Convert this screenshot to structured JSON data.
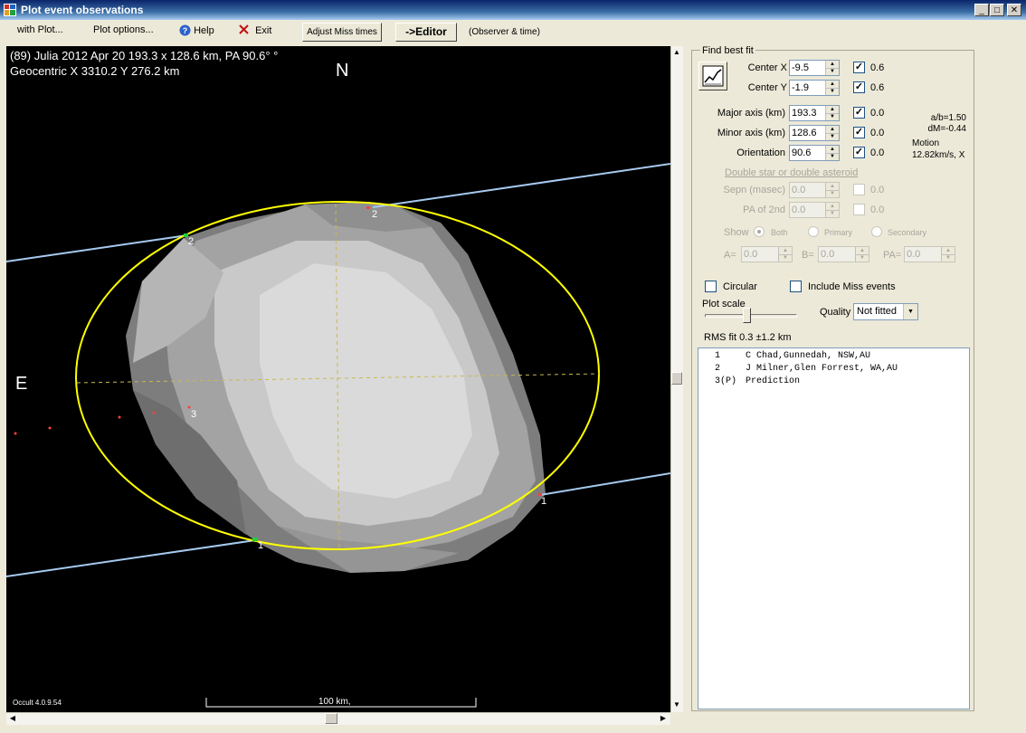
{
  "window": {
    "title": "Plot event observations"
  },
  "menu": {
    "with_plot": "with Plot...",
    "plot_options": "Plot options...",
    "help": "Help",
    "exit": "Exit",
    "adjust_miss_times": "Adjust Miss times",
    "editor": "->Editor",
    "observer_time": "(Observer & time)"
  },
  "plot": {
    "header_line1": "(89) Julia  2012 Apr 20   193.3 x 128.6 km, PA 90.6° °",
    "header_line2": "Geocentric X  3310.2  Y 276.2 km",
    "north": "N",
    "east": "E",
    "version": "Occult 4.0.9.54",
    "scale_label": "100 km,",
    "chord_labels": [
      {
        "text": "2"
      },
      {
        "text": "2"
      },
      {
        "text": "1"
      },
      {
        "text": "1"
      },
      {
        "text": "3"
      }
    ],
    "colors": {
      "background": "#000000",
      "ellipse": "#ffff00",
      "chord": "#a6caf0",
      "axis": "#c8b850"
    }
  },
  "fit": {
    "group_title": "Find best fit",
    "center_x": {
      "label": "Center X",
      "value": "-9.5",
      "checked": true,
      "step": "0.6"
    },
    "center_y": {
      "label": "Center Y",
      "value": "-1.9",
      "checked": true,
      "step": "0.6"
    },
    "major_axis": {
      "label": "Major axis (km)",
      "value": "193.3",
      "checked": true,
      "step": "0.0"
    },
    "minor_axis": {
      "label": "Minor axis (km)",
      "value": "128.6",
      "checked": true,
      "step": "0.0"
    },
    "orientation": {
      "label": "Orientation",
      "value": "90.6",
      "checked": true,
      "step": "0.0"
    },
    "ab": "a/b=1.50",
    "dm": "dM=-0.44",
    "motion_label": "Motion",
    "motion_value": "12.82km/s, X",
    "double_link": "Double star  or  double asteroid",
    "sepn": {
      "label": "Sepn (masec)",
      "value": "0.0",
      "step": "0.0"
    },
    "pa2nd": {
      "label": "PA of 2nd",
      "value": "0.0",
      "step": "0.0"
    },
    "show_label": "Show",
    "show_both": "Both",
    "show_primary": "Primary",
    "show_secondary": "Secondary",
    "a_label": "A=",
    "a_value": "0.0",
    "b_label": "B=",
    "b_value": "0.0",
    "pa_label": "PA=",
    "pa_value": "0.0",
    "circular": "Circular",
    "include_miss": "Include Miss events",
    "plot_scale": "Plot scale",
    "plot_scale_level": 0.45,
    "quality_label": "Quality",
    "quality_value": "Not fitted",
    "rms": "RMS fit 0.3 ±1.2 km"
  },
  "observers": [
    {
      "id": "1",
      "name": "C Chad,Gunnedah, NSW,AU"
    },
    {
      "id": "2",
      "name": "J Milner,Glen Forrest, WA,AU"
    },
    {
      "id": "3(P)",
      "name": "Prediction"
    }
  ]
}
